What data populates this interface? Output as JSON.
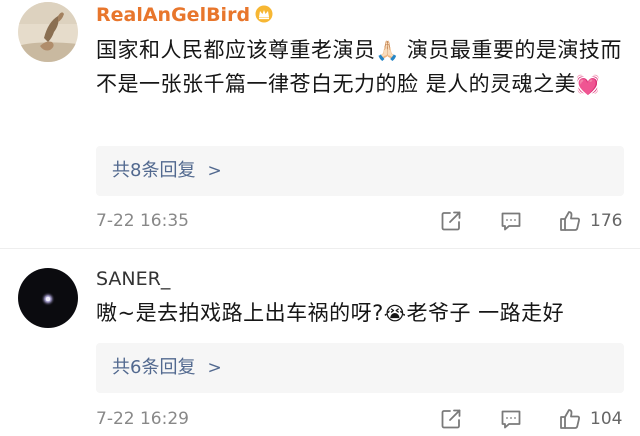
{
  "comments": [
    {
      "username": "RealAnGelBird",
      "badge_icon": "crown-badge-icon",
      "content_text_1": "国家和人民都应该尊重老演员",
      "content_emoji_1": "🙏🏻",
      "content_text_2": "  演员最重要的是演技而不是一张张千篇一律苍白无力的脸 是人的灵魂之美",
      "content_emoji_2": "💓",
      "replies_label": "共8条回复",
      "timestamp": "7-22 16:35",
      "likes": "176"
    },
    {
      "username": "SANER_",
      "content_text_1": "嗷~是去拍戏路上出车祸的呀?",
      "content_emoji_1": "😭",
      "content_text_2": "老爷子 一路走好",
      "replies_label": "共6条回复",
      "timestamp": "7-22 16:29",
      "likes": "104"
    }
  ],
  "colors": {
    "username_vip": "#e8762c",
    "link": "#52698f",
    "muted": "#888888",
    "reply_bg": "#f6f6f6"
  }
}
